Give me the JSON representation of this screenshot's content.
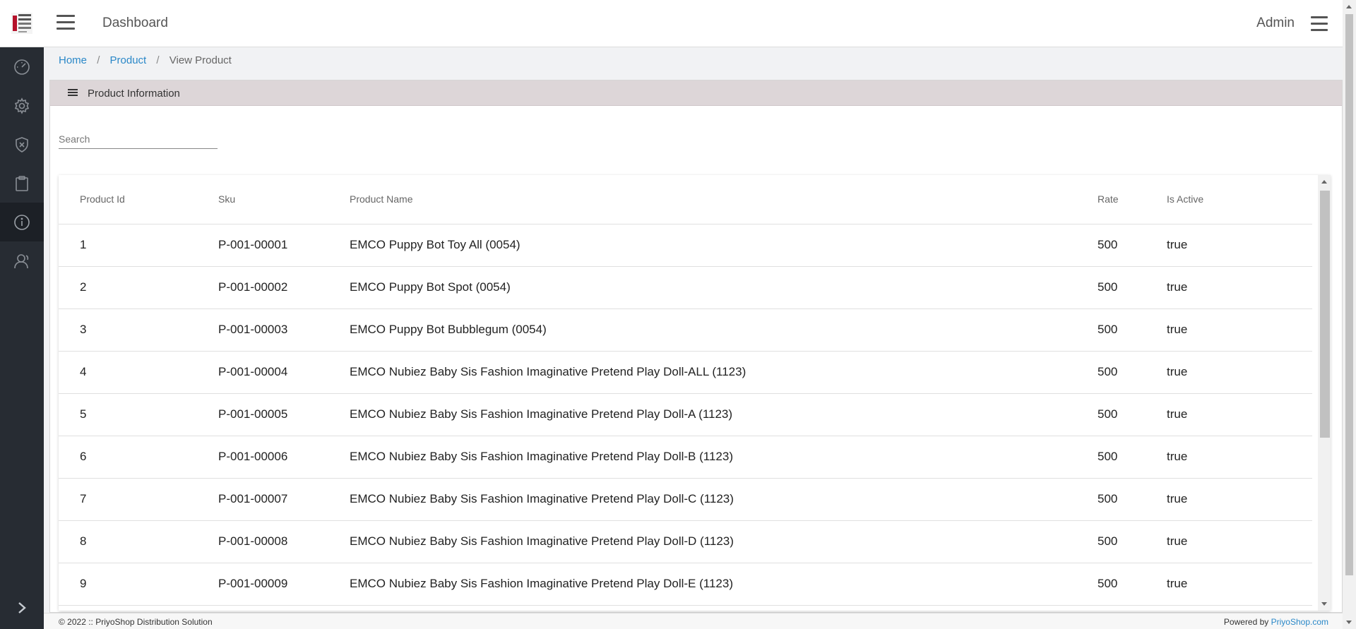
{
  "header": {
    "title": "Dashboard",
    "user_label": "Admin",
    "logo_icon": "shop-logo-icon",
    "menu_icon": "hamburger-icon"
  },
  "sidebar": {
    "items": [
      {
        "icon": "speedometer-icon",
        "active": false
      },
      {
        "icon": "gear-icon",
        "active": false
      },
      {
        "icon": "shield-icon",
        "active": false
      },
      {
        "icon": "clipboard-icon",
        "active": false
      },
      {
        "icon": "info-icon",
        "active": true
      },
      {
        "icon": "user-icon",
        "active": false
      }
    ],
    "toggle_icon": "chevron-right-icon"
  },
  "breadcrumb": {
    "home": "Home",
    "product": "Product",
    "current": "View Product",
    "separator": "/"
  },
  "card": {
    "title": "Product Information",
    "icon": "list-icon"
  },
  "search": {
    "placeholder": "Search",
    "value": ""
  },
  "table": {
    "columns": [
      "Product Id",
      "Sku",
      "Product Name",
      "Rate",
      "Is Active"
    ],
    "rows": [
      [
        "1",
        "P-001-00001",
        "EMCO Puppy Bot Toy All (0054)",
        "500",
        "true"
      ],
      [
        "2",
        "P-001-00002",
        "EMCO Puppy Bot Spot (0054)",
        "500",
        "true"
      ],
      [
        "3",
        "P-001-00003",
        "EMCO Puppy Bot Bubblegum (0054)",
        "500",
        "true"
      ],
      [
        "4",
        "P-001-00004",
        "EMCO Nubiez Baby Sis Fashion Imaginative Pretend Play Doll-ALL (1123)",
        "500",
        "true"
      ],
      [
        "5",
        "P-001-00005",
        "EMCO Nubiez Baby Sis Fashion Imaginative Pretend Play Doll-A (1123)",
        "500",
        "true"
      ],
      [
        "6",
        "P-001-00006",
        "EMCO Nubiez Baby Sis Fashion Imaginative Pretend Play Doll-B (1123)",
        "500",
        "true"
      ],
      [
        "7",
        "P-001-00007",
        "EMCO Nubiez Baby Sis Fashion Imaginative Pretend Play Doll-C (1123)",
        "500",
        "true"
      ],
      [
        "8",
        "P-001-00008",
        "EMCO Nubiez Baby Sis Fashion Imaginative Pretend Play Doll-D (1123)",
        "500",
        "true"
      ],
      [
        "9",
        "P-001-00009",
        "EMCO Nubiez Baby Sis Fashion Imaginative Pretend Play Doll-E (1123)",
        "500",
        "true"
      ]
    ]
  },
  "footer": {
    "copyright": "© 2022 :: PriyoShop Distribution Solution",
    "powered_prefix": "Powered by ",
    "powered_link": "PriyoShop.com"
  },
  "colors": {
    "sidebar_bg": "#272c33",
    "link": "#2a88c8",
    "card_header_bg": "#ddd6d8"
  }
}
